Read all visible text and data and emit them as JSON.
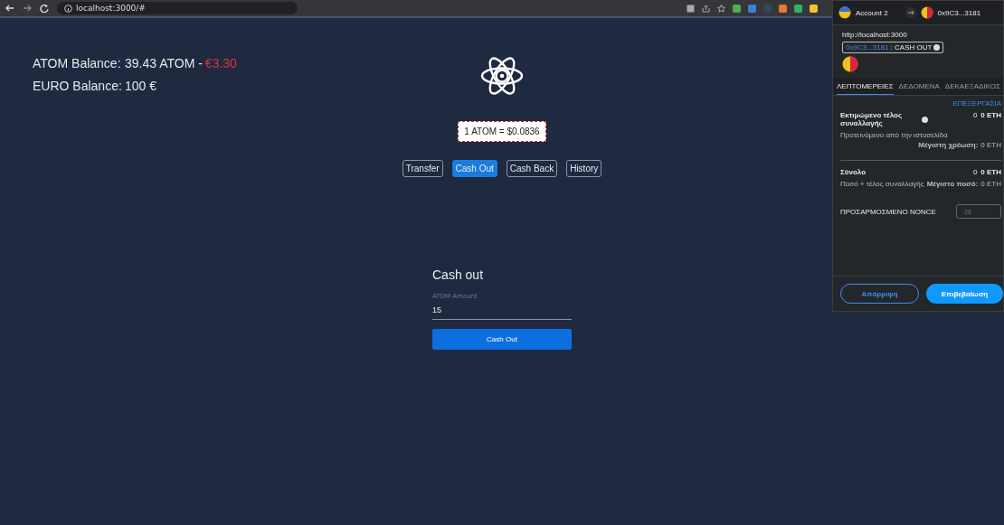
{
  "browser": {
    "url": "localhost:3000/#",
    "extensions": [
      {
        "color": "#4caf50"
      },
      {
        "color": "#3f7fd8"
      },
      {
        "color": "#2d4a5a"
      },
      {
        "color": "#e8772e"
      },
      {
        "color": "#2fb36b"
      },
      {
        "color": "#f2c230"
      }
    ]
  },
  "balances": [
    {
      "label": "ATOM Balance:",
      "value": "39.43 ATOM - ",
      "value_extra": "€3.30"
    },
    {
      "label": "EURO Balance:",
      "value": "100 €"
    }
  ],
  "price": "1 ATOM = $0.0836",
  "nav": [
    {
      "label": "Transfer",
      "selected": false
    },
    {
      "label": "Cash Out",
      "selected": true
    },
    {
      "label": "Cash Back",
      "selected": false
    },
    {
      "label": "History",
      "selected": false
    }
  ],
  "form": {
    "title": "Cash out",
    "field_label": "ATOM Amount",
    "value": "15",
    "button": "Cash Out"
  },
  "wallet": {
    "account": "Account 2",
    "to_address": "0x9C3...3181",
    "origin": "http://localhost:3000",
    "action_address": "0x9C3...3181",
    "action": ": CASH OUT",
    "tabs": [
      {
        "label": "ΛΕΠΤΟΜΕΡΕΙΕΣ",
        "selected": true
      },
      {
        "label": "ΔΕΔΟΜΕΝΑ",
        "selected": false
      },
      {
        "label": "ΔΕΚΑΕΞΑΔΙΚΟΣ",
        "selected": false
      }
    ],
    "edit": "ΕΠΕΞΕΡΓΑΣΙΑ",
    "sections": [
      {
        "title": "Εκτιμώμενο τέλος συναλλαγής",
        "info": true,
        "amount_small": "0",
        "amount": "0 ETH",
        "note": "Προτεινόμενο από την ιστοσελίδα",
        "max_label": "Μέγιστη χρέωση:",
        "max_value": "0 ETH"
      },
      {
        "title": "Σύνολο",
        "info": false,
        "amount_small": "0",
        "amount": "0 ETH",
        "note": "Ποσό + τέλος συναλλαγής",
        "max_label": "Μέγιστο ποσό:",
        "max_value": "0 ETH"
      }
    ],
    "nonce_label": "ΠΡΟΣΑΡΜΟΣΜΕΝΟ NONCE",
    "nonce_value": "26",
    "buttons": [
      {
        "label": "Απόρριψη",
        "kind": "secondary"
      },
      {
        "label": "Επιβεβαίωση",
        "kind": "primary"
      }
    ]
  }
}
